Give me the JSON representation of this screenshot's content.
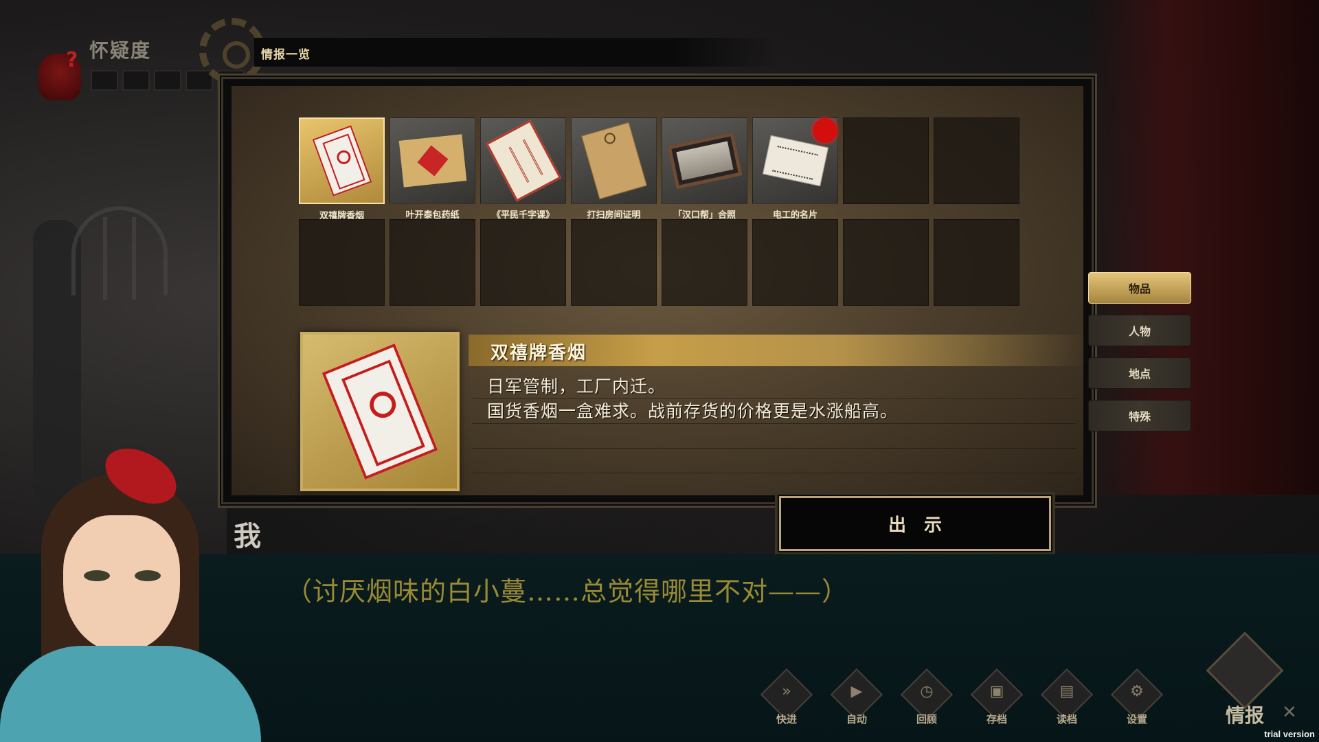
{
  "suspicion": {
    "label": "怀疑度",
    "segments": 5,
    "filled": 0
  },
  "header": {
    "title": "情报一览"
  },
  "items": [
    {
      "label": "双禧牌香烟",
      "icon": "cigarette-pack",
      "selected": true,
      "badge": false
    },
    {
      "label": "叶开泰包药纸",
      "icon": "medicine-paper",
      "selected": false,
      "badge": false
    },
    {
      "label": "《平民千字课》",
      "icon": "book",
      "selected": false,
      "badge": false
    },
    {
      "label": "打扫房间证明",
      "icon": "document-folder",
      "selected": false,
      "badge": false
    },
    {
      "label": "「汉口帮」合照",
      "icon": "group-photo",
      "selected": false,
      "badge": false
    },
    {
      "label": "电工的名片",
      "icon": "business-card",
      "selected": false,
      "badge": true
    }
  ],
  "empty_slots": 10,
  "detail": {
    "title": "双禧牌香烟",
    "lines": [
      "日军管制，工厂内迁。",
      "国货香烟一盒难求。战前存货的价格更是水涨船高。"
    ]
  },
  "tabs": [
    {
      "label": "物品",
      "active": true
    },
    {
      "label": "人物",
      "active": false
    },
    {
      "label": "地点",
      "active": false
    },
    {
      "label": "特殊",
      "active": false
    }
  ],
  "show_button": "出示",
  "dialogue": {
    "speaker": "我",
    "text": "（讨厌烟味的白小蔓……总觉得哪里不对——）"
  },
  "toolbar": [
    {
      "label": "快进",
      "icon": "fast-forward-icon",
      "glyph": "»"
    },
    {
      "label": "自动",
      "icon": "auto-play-icon",
      "glyph": "▶"
    },
    {
      "label": "回顾",
      "icon": "history-clock-icon",
      "glyph": "◷"
    },
    {
      "label": "存档",
      "icon": "camera-save-icon",
      "glyph": "▣"
    },
    {
      "label": "读档",
      "icon": "photo-load-icon",
      "glyph": "▤"
    },
    {
      "label": "设置",
      "icon": "gear-settings-icon",
      "glyph": "⚙"
    }
  ],
  "intel_button": {
    "label": "情报"
  },
  "close_glyph": "✕",
  "watermark": "trial version"
}
